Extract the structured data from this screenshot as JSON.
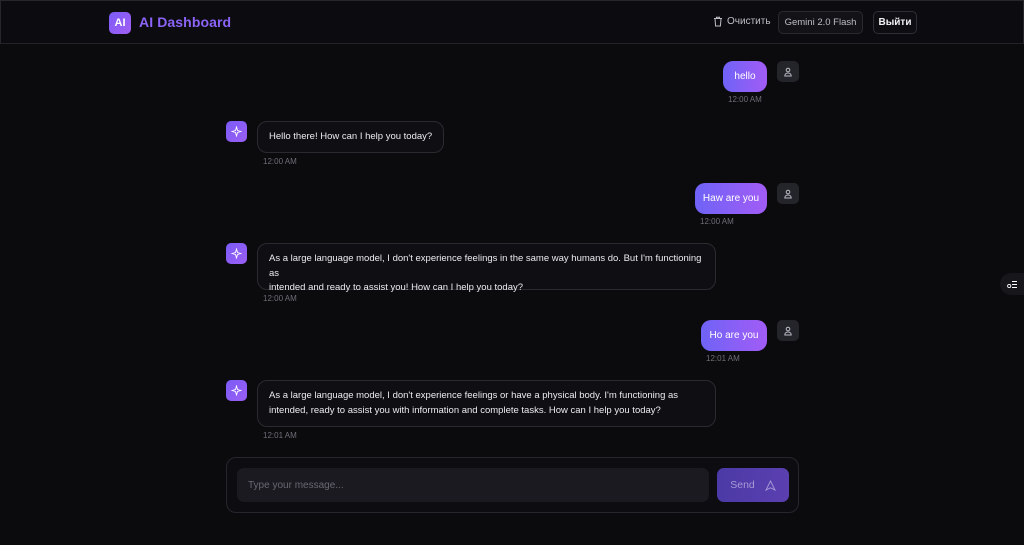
{
  "header": {
    "logo_text": "AI",
    "title": "AI Dashboard",
    "clear_label": "Очистить",
    "model_label": "Gemini 2.0 Flash",
    "logout_label": "Выйти"
  },
  "messages": [
    {
      "role": "user",
      "text": "hello",
      "time": "12:00 AM"
    },
    {
      "role": "assistant",
      "text": "Hello there! How can I help you today?",
      "time": "12:00 AM"
    },
    {
      "role": "user",
      "text": "Haw are you",
      "time": "12:00 AM"
    },
    {
      "role": "assistant",
      "lines": [
        "As a large language model, I don't experience feelings in the same way humans do. But I'm functioning as",
        "intended and ready to assist you! How can I help you today?"
      ],
      "time": "12:00 AM"
    },
    {
      "role": "user",
      "text": "Ho are you",
      "time": "12:01 AM"
    },
    {
      "role": "assistant",
      "lines": [
        "As a large language model, I don't experience feelings or have a physical body. I'm functioning as",
        "intended, ready to assist you with information and complete tasks. How can I help you today?"
      ],
      "time": "12:01 AM"
    }
  ],
  "composer": {
    "placeholder": "Type your message...",
    "send_label": "Send"
  },
  "icons": {
    "clear": "trash-icon",
    "user": "user-icon",
    "assistant": "sparkle-icon",
    "send": "send-icon",
    "side": "sidebar-toggle-icon"
  },
  "colors": {
    "accent": "#8b64f7",
    "user_bubble_start": "#6f63f6",
    "user_bubble_end": "#a25cf6",
    "background": "#0b0b0e"
  }
}
